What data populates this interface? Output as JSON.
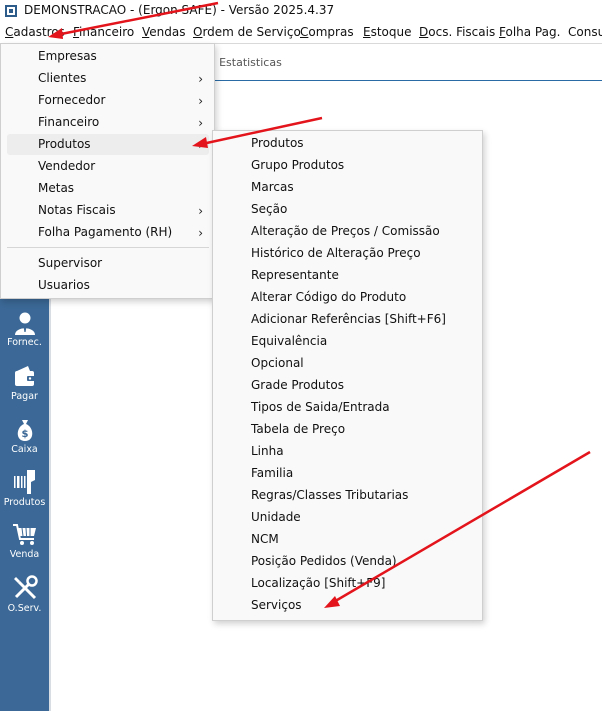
{
  "window": {
    "title": "DEMONSTRACAO - (Ergon SAFE) - Versão 2025.4.37"
  },
  "menubar": {
    "items": [
      {
        "label": "Cadastros",
        "mnemonic": "C",
        "rest": "adastros"
      },
      {
        "label": "Financeiro",
        "mnemonic": "F",
        "rest": "inanceiro"
      },
      {
        "label": "Vendas",
        "mnemonic": "V",
        "rest": "endas"
      },
      {
        "label": "Ordem de Serviço",
        "mnemonic": "O",
        "rest": "rdem de Serviço"
      },
      {
        "label": "Compras",
        "mnemonic": "C",
        "rest": "ompras"
      },
      {
        "label": "Estoque",
        "mnemonic": "E",
        "rest": "stoque"
      },
      {
        "label": "Docs. Fiscais",
        "mnemonic": "D",
        "rest": "ocs. Fiscais"
      },
      {
        "label": "Folha Pag.",
        "mnemonic": "F",
        "rest": "olha Pag."
      },
      {
        "label": "Consu",
        "mnemonic": "",
        "rest": "Consu"
      }
    ]
  },
  "tab_fragment": "[2] Estatisticas",
  "toolbar": {
    "items": [
      {
        "label": "Fornec.",
        "icon": "supplier-person-icon"
      },
      {
        "label": "Pagar",
        "icon": "wallet-icon"
      },
      {
        "label": "Caixa",
        "icon": "money-bag-icon"
      },
      {
        "label": "Produtos",
        "icon": "barcode-scanner-icon"
      },
      {
        "label": "Venda",
        "icon": "shopping-cart-icon"
      },
      {
        "label": "O.Serv.",
        "icon": "tools-icon"
      }
    ]
  },
  "cadastros_menu": {
    "items": [
      {
        "label": "Empresas",
        "submenu": false
      },
      {
        "label": "Clientes",
        "submenu": true
      },
      {
        "label": "Fornecedor",
        "submenu": true
      },
      {
        "label": "Financeiro",
        "submenu": true
      },
      {
        "label": "Produtos",
        "submenu": true,
        "highlighted": true
      },
      {
        "label": "Vendedor",
        "submenu": false
      },
      {
        "label": "Metas",
        "submenu": false
      },
      {
        "label": "Notas Fiscais",
        "submenu": true
      },
      {
        "label": "Folha Pagamento (RH)",
        "submenu": true
      },
      {
        "label": "Supervisor",
        "submenu": false
      },
      {
        "label": "Usuarios",
        "submenu": false
      }
    ],
    "chevron": "›"
  },
  "produtos_submenu": {
    "items": [
      "Produtos",
      "Grupo Produtos",
      "Marcas",
      "Seção",
      "Alteração de Preços / Comissão",
      "Histórico de Alteração Preço",
      "Representante",
      "Alterar Código do Produto",
      "Adicionar Referências  [Shift+F6]",
      "Equivalência",
      "Opcional",
      "Grade Produtos",
      "Tipos de Saida/Entrada",
      "Tabela de Preço",
      "Linha",
      "Familia",
      "Regras/Classes Tributarias",
      "Unidade",
      "NCM",
      "Posição Pedidos (Venda)",
      "Localização [Shift+F9]",
      "Serviços"
    ]
  },
  "colors": {
    "sidebar": "#3b6896",
    "annotation_arrow": "#e3141b",
    "menu_bg": "#f9f9f9",
    "highlight": "#ededed"
  }
}
